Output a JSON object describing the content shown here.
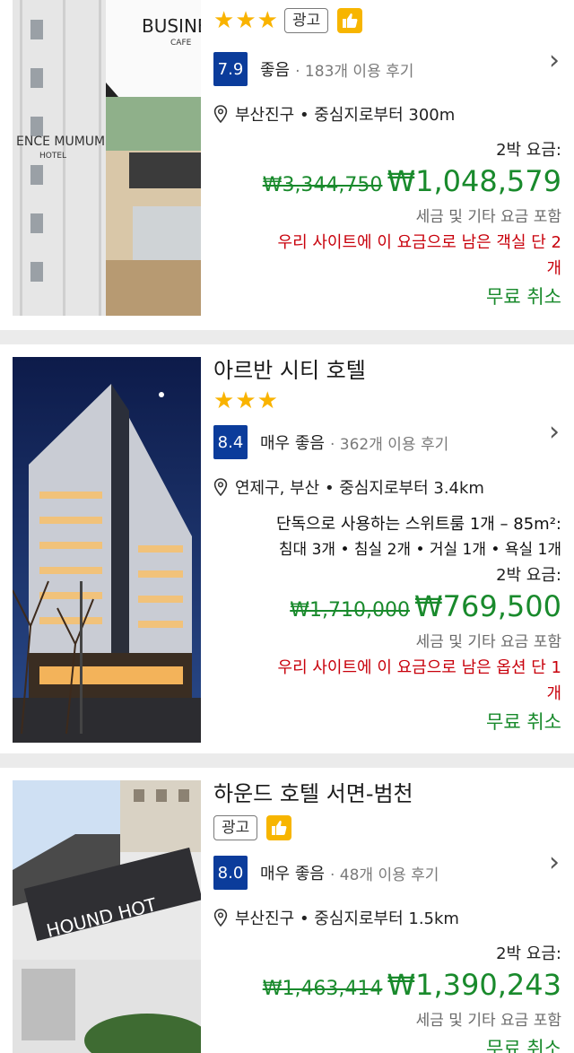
{
  "listings": [
    {
      "stars": 3,
      "ad_label": "광고",
      "score": "7.9",
      "rating_label": "좋음",
      "review_count": "· 183개 이용 후기",
      "location": "부산진구 • 중심지로부터 300m",
      "photo_texts": {
        "sign": "BUSINE",
        "sign_sub": "CAFE",
        "hotel": "ENCE MUMUM",
        "hotel_sub": "HOTEL"
      },
      "nights_label": "2박 요금:",
      "old_price": "₩3,344,750",
      "price": "₩1,048,579",
      "tax_note": "세금 및 기타 요금 포함",
      "scarcity_lines": [
        "우리 사이트에 이 요금으로 남은 객실 단 2",
        "개"
      ],
      "cancel": "무료 취소"
    },
    {
      "title": "아르반 시티 호텔",
      "stars": 3,
      "score": "8.4",
      "rating_label": "매우 좋음",
      "review_count": "· 362개 이용 후기",
      "location": "연제구, 부산 • 중심지로부터 3.4km",
      "room_lines": [
        "단독으로 사용하는 스위트룸 1개 – 85m²:",
        "침대 3개 • 침실 2개 • 거실 1개 • 욕실 1개"
      ],
      "nights_label": "2박 요금:",
      "old_price": "₩1,710,000",
      "price": "₩769,500",
      "tax_note": "세금 및 기타 요금 포함",
      "scarcity_lines": [
        "우리 사이트에 이 요금으로 남은 옵션 단 1",
        "개"
      ],
      "cancel": "무료 취소"
    },
    {
      "title": "하운드 호텔 서면-범천",
      "ad_label": "광고",
      "score": "8.0",
      "rating_label": "매우 좋음",
      "review_count": "· 48개 이용 후기",
      "location": "부산진구 • 중심지로부터 1.5km",
      "photo_texts": {
        "sign": "HOUND HOT"
      },
      "nights_label": "2박 요금:",
      "old_price": "₩1,463,414",
      "price": "₩1,390,243",
      "tax_note": "세금 및 기타 요금 포함",
      "cancel": "무료 취소"
    }
  ],
  "icons": {
    "star": "star-icon",
    "thumb": "thumbs-up-icon",
    "pin": "map-pin-icon",
    "chevron": "chevron-right-icon"
  },
  "colors": {
    "score_bg": "#0b3c9b",
    "price_green": "#198a2c",
    "scarcity_red": "#c8000b",
    "star_yellow": "#f9b300"
  }
}
